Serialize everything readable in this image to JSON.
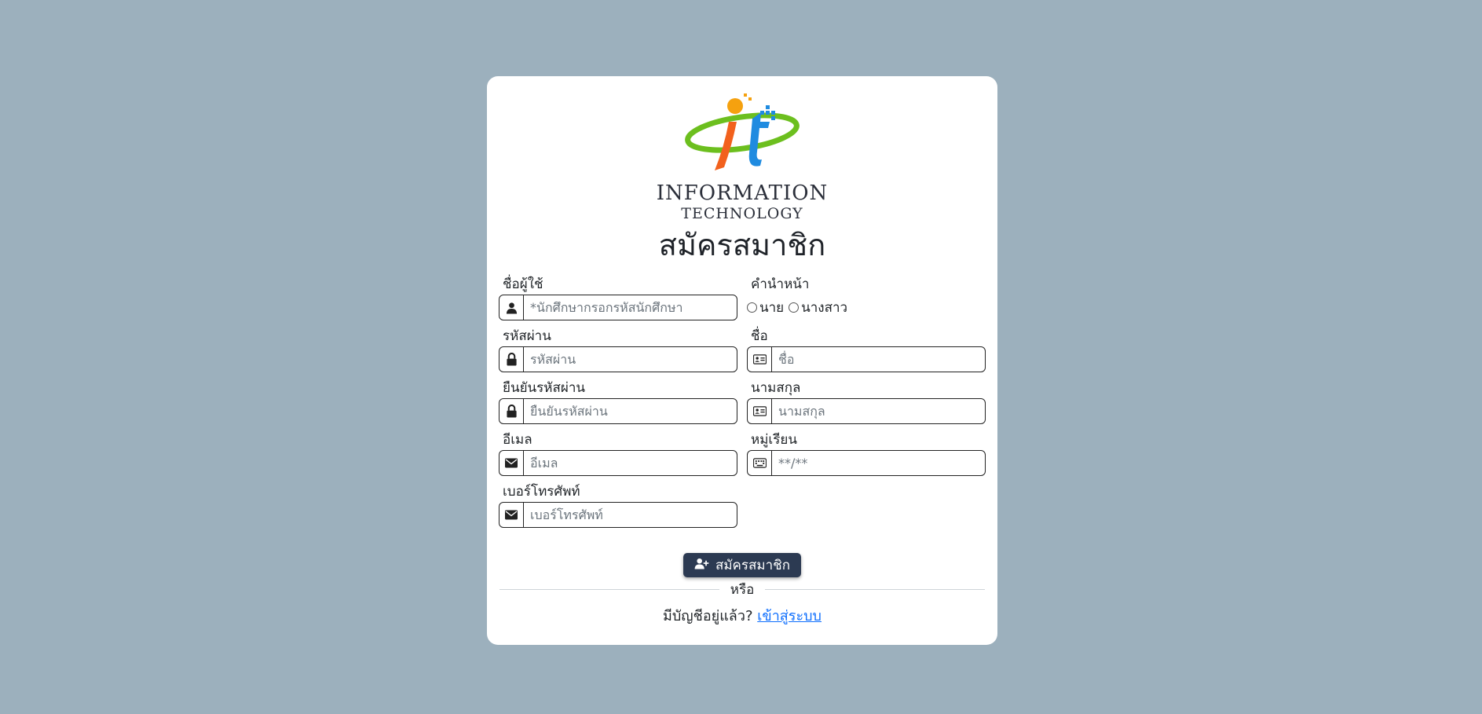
{
  "logo": {
    "line1": "INFORMATION",
    "line2": "TECHNOLOGY"
  },
  "title": "สมัครสมาชิก",
  "form": {
    "username": {
      "label": "ชื่อผู้ใช้",
      "placeholder": "*นักศึกษากรอกรหัสนักศึกษา",
      "value": "",
      "icon": "user-icon"
    },
    "prefix": {
      "label": "คำนำหน้า",
      "options": [
        "นาย",
        "นางสาว"
      ]
    },
    "password": {
      "label": "รหัสผ่าน",
      "placeholder": "รหัสผ่าน",
      "value": "",
      "icon": "lock-icon"
    },
    "firstname": {
      "label": "ชื่อ",
      "placeholder": "ชื่อ",
      "value": "",
      "icon": "id-card-icon"
    },
    "confirm_password": {
      "label": "ยืนยันรหัสผ่าน",
      "placeholder": "ยืนยันรหัสผ่าน",
      "value": "",
      "icon": "lock-icon"
    },
    "lastname": {
      "label": "นามสกุล",
      "placeholder": "นามสกุล",
      "value": "",
      "icon": "id-card-icon"
    },
    "email": {
      "label": "อีเมล",
      "placeholder": "อีเมล",
      "value": "",
      "icon": "envelope-icon"
    },
    "group": {
      "label": "หมู่เรียน",
      "placeholder": "**/**",
      "value": "",
      "icon": "keyboard-icon"
    },
    "phone": {
      "label": "เบอร์โทรศัพท์",
      "placeholder": "เบอร์โทรศัพท์",
      "value": "",
      "icon": "envelope-icon"
    }
  },
  "submit": {
    "label": "สมัครสมาชิก",
    "icon": "user-plus-icon"
  },
  "divider": "หรือ",
  "login": {
    "prompt": "มีบัญชีอยู่แล้ว?",
    "link": "เข้าสู่ระบบ"
  },
  "colors": {
    "background": "#9cb0bd",
    "card": "#ffffff",
    "button": "#2c3a52",
    "link": "#0d6efd"
  }
}
